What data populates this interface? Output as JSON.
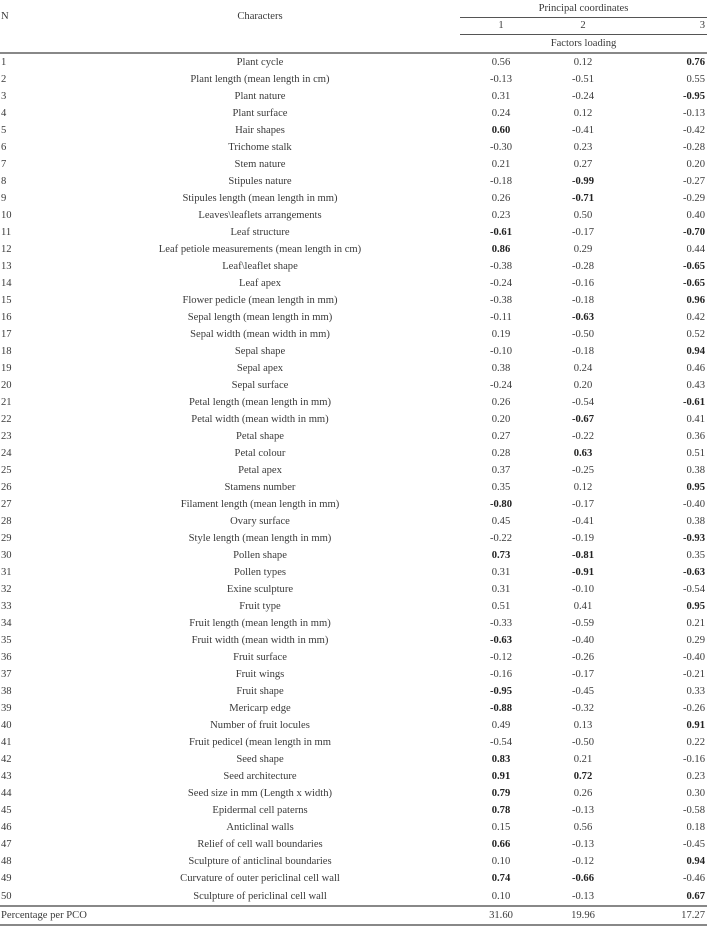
{
  "header": {
    "n_label": "N",
    "characters_label": "Characters",
    "group_label": "Principal coordinates",
    "columns": [
      "1",
      "2",
      "3"
    ],
    "subheader": "Factors loading"
  },
  "rows": [
    {
      "n": "1",
      "character": "Plant cycle",
      "values": [
        "0.56",
        "0.12",
        "0.76"
      ],
      "bold": [
        false,
        false,
        true
      ]
    },
    {
      "n": "2",
      "character": "Plant length (mean length in cm)",
      "values": [
        "-0.13",
        "-0.51",
        "0.55"
      ],
      "bold": [
        false,
        false,
        false
      ]
    },
    {
      "n": "3",
      "character": "Plant nature",
      "values": [
        "0.31",
        "-0.24",
        "-0.95"
      ],
      "bold": [
        false,
        false,
        true
      ]
    },
    {
      "n": "4",
      "character": "Plant surface",
      "values": [
        "0.24",
        "0.12",
        "-0.13"
      ],
      "bold": [
        false,
        false,
        false
      ]
    },
    {
      "n": "5",
      "character": "Hair shapes",
      "values": [
        "0.60",
        "-0.41",
        "-0.42"
      ],
      "bold": [
        true,
        false,
        false
      ]
    },
    {
      "n": "6",
      "character": "Trichome stalk",
      "values": [
        "-0.30",
        "0.23",
        "-0.28"
      ],
      "bold": [
        false,
        false,
        false
      ]
    },
    {
      "n": "7",
      "character": "Stem nature",
      "values": [
        "0.21",
        "0.27",
        "0.20"
      ],
      "bold": [
        false,
        false,
        false
      ]
    },
    {
      "n": "8",
      "character": "Stipules nature",
      "values": [
        "-0.18",
        "-0.99",
        "-0.27"
      ],
      "bold": [
        false,
        true,
        false
      ]
    },
    {
      "n": "9",
      "character": "Stipules length (mean length in mm)",
      "values": [
        "0.26",
        "-0.71",
        "-0.29"
      ],
      "bold": [
        false,
        true,
        false
      ]
    },
    {
      "n": "10",
      "character": "Leaves\\leaflets arrangements",
      "values": [
        "0.23",
        "0.50",
        "0.40"
      ],
      "bold": [
        false,
        false,
        false
      ]
    },
    {
      "n": "11",
      "character": "Leaf structure",
      "values": [
        "-0.61",
        "-0.17",
        "-0.70"
      ],
      "bold": [
        true,
        false,
        true
      ]
    },
    {
      "n": "12",
      "character": "Leaf petiole measurements (mean length in cm)",
      "values": [
        "0.86",
        "0.29",
        "0.44"
      ],
      "bold": [
        true,
        false,
        false
      ]
    },
    {
      "n": "13",
      "character": "Leaf\\leaflet shape",
      "values": [
        "-0.38",
        "-0.28",
        "-0.65"
      ],
      "bold": [
        false,
        false,
        true
      ]
    },
    {
      "n": "14",
      "character": "Leaf apex",
      "values": [
        "-0.24",
        "-0.16",
        "-0.65"
      ],
      "bold": [
        false,
        false,
        true
      ]
    },
    {
      "n": "15",
      "character": "Flower pedicle (mean length in mm)",
      "values": [
        "-0.38",
        "-0.18",
        "0.96"
      ],
      "bold": [
        false,
        false,
        true
      ]
    },
    {
      "n": "16",
      "character": "Sepal length  (mean length in mm)",
      "values": [
        "-0.11",
        "-0.63",
        "0.42"
      ],
      "bold": [
        false,
        true,
        false
      ]
    },
    {
      "n": "17",
      "character": "Sepal width (mean width in mm)",
      "values": [
        "0.19",
        "-0.50",
        "0.52"
      ],
      "bold": [
        false,
        false,
        false
      ]
    },
    {
      "n": "18",
      "character": "Sepal shape",
      "values": [
        "-0.10",
        "-0.18",
        "0.94"
      ],
      "bold": [
        false,
        false,
        true
      ]
    },
    {
      "n": "19",
      "character": "Sepal apex",
      "values": [
        "0.38",
        "0.24",
        "0.46"
      ],
      "bold": [
        false,
        false,
        false
      ]
    },
    {
      "n": "20",
      "character": "Sepal surface",
      "values": [
        "-0.24",
        "0.20",
        "0.43"
      ],
      "bold": [
        false,
        false,
        false
      ]
    },
    {
      "n": "21",
      "character": "Petal length (mean length in mm)",
      "values": [
        "0.26",
        "-0.54",
        "-0.61"
      ],
      "bold": [
        false,
        false,
        true
      ]
    },
    {
      "n": "22",
      "character": "Petal width (mean width in mm)",
      "values": [
        "0.20",
        "-0.67",
        "0.41"
      ],
      "bold": [
        false,
        true,
        false
      ]
    },
    {
      "n": "23",
      "character": "Petal shape",
      "values": [
        "0.27",
        "-0.22",
        "0.36"
      ],
      "bold": [
        false,
        false,
        false
      ]
    },
    {
      "n": "24",
      "character": "Petal colour",
      "values": [
        "0.28",
        "0.63",
        "0.51"
      ],
      "bold": [
        false,
        true,
        false
      ]
    },
    {
      "n": "25",
      "character": "Petal apex",
      "values": [
        "0.37",
        "-0.25",
        "0.38"
      ],
      "bold": [
        false,
        false,
        false
      ]
    },
    {
      "n": "26",
      "character": "Stamens number",
      "values": [
        "0.35",
        "0.12",
        "0.95"
      ],
      "bold": [
        false,
        false,
        true
      ]
    },
    {
      "n": "27",
      "character": "Filament length (mean length in mm)",
      "values": [
        "-0.80",
        "-0.17",
        "-0.40"
      ],
      "bold": [
        true,
        false,
        false
      ]
    },
    {
      "n": "28",
      "character": "Ovary surface",
      "values": [
        "0.45",
        "-0.41",
        "0.38"
      ],
      "bold": [
        false,
        false,
        false
      ]
    },
    {
      "n": "29",
      "character": "Style length (mean length in mm)",
      "values": [
        "-0.22",
        "-0.19",
        "-0.93"
      ],
      "bold": [
        false,
        false,
        true
      ]
    },
    {
      "n": "30",
      "character": "Pollen shape",
      "values": [
        "0.73",
        "-0.81",
        "0.35"
      ],
      "bold": [
        true,
        true,
        false
      ]
    },
    {
      "n": "31",
      "character": "Pollen types",
      "values": [
        "0.31",
        "-0.91",
        "-0.63"
      ],
      "bold": [
        false,
        true,
        true
      ]
    },
    {
      "n": "32",
      "character": "Exine sculpture",
      "values": [
        "0.31",
        "-0.10",
        "-0.54"
      ],
      "bold": [
        false,
        false,
        false
      ]
    },
    {
      "n": "33",
      "character": "Fruit type",
      "values": [
        "0.51",
        "0.41",
        "0.95"
      ],
      "bold": [
        false,
        false,
        true
      ]
    },
    {
      "n": "34",
      "character": "Fruit length (mean length in mm)",
      "values": [
        "-0.33",
        "-0.59",
        "0.21"
      ],
      "bold": [
        false,
        false,
        false
      ]
    },
    {
      "n": "35",
      "character": "Fruit width (mean width in mm)",
      "values": [
        "-0.63",
        "-0.40",
        "0.29"
      ],
      "bold": [
        true,
        false,
        false
      ]
    },
    {
      "n": "36",
      "character": "Fruit surface",
      "values": [
        "-0.12",
        "-0.26",
        "-0.40"
      ],
      "bold": [
        false,
        false,
        false
      ]
    },
    {
      "n": "37",
      "character": "Fruit wings",
      "values": [
        "-0.16",
        "-0.17",
        "-0.21"
      ],
      "bold": [
        false,
        false,
        false
      ]
    },
    {
      "n": "38",
      "character": "Fruit shape",
      "values": [
        "-0.95",
        "-0.45",
        "0.33"
      ],
      "bold": [
        true,
        false,
        false
      ]
    },
    {
      "n": "39",
      "character": "Mericarp edge",
      "values": [
        "-0.88",
        "-0.32",
        "-0.26"
      ],
      "bold": [
        true,
        false,
        false
      ]
    },
    {
      "n": "40",
      "character": "Number of fruit locules",
      "values": [
        "0.49",
        "0.13",
        "0.91"
      ],
      "bold": [
        false,
        false,
        true
      ]
    },
    {
      "n": "41",
      "character": "Fruit pedicel (mean length in mm",
      "values": [
        "-0.54",
        "-0.50",
        "0.22"
      ],
      "bold": [
        false,
        false,
        false
      ]
    },
    {
      "n": "42",
      "character": "Seed shape",
      "values": [
        "0.83",
        "0.21",
        "-0.16"
      ],
      "bold": [
        true,
        false,
        false
      ]
    },
    {
      "n": "43",
      "character": "Seed architecture",
      "values": [
        "0.91",
        "0.72",
        "0.23"
      ],
      "bold": [
        true,
        true,
        false
      ]
    },
    {
      "n": "44",
      "character": "Seed size in mm (Length x width)",
      "values": [
        "0.79",
        "0.26",
        "0.30"
      ],
      "bold": [
        true,
        false,
        false
      ]
    },
    {
      "n": "45",
      "character": "Epidermal cell paterns",
      "values": [
        "0.78",
        "-0.13",
        "-0.58"
      ],
      "bold": [
        true,
        false,
        false
      ]
    },
    {
      "n": "46",
      "character": "Anticlinal walls",
      "values": [
        "0.15",
        "0.56",
        "0.18"
      ],
      "bold": [
        false,
        false,
        false
      ]
    },
    {
      "n": "47",
      "character": "Relief of cell wall boundaries",
      "values": [
        "0.66",
        "-0.13",
        "-0.45"
      ],
      "bold": [
        true,
        false,
        false
      ]
    },
    {
      "n": "48",
      "character": "Sculpture of anticlinal boundaries",
      "values": [
        "0.10",
        "-0.12",
        "0.94"
      ],
      "bold": [
        false,
        false,
        true
      ]
    },
    {
      "n": "49",
      "character": "Curvature of outer periclinal cell wall",
      "values": [
        "0.74",
        "-0.66",
        "-0.46"
      ],
      "bold": [
        true,
        true,
        false
      ]
    },
    {
      "n": "50",
      "character": "Sculpture of periclinal cell wall",
      "values": [
        "0.10",
        "-0.13",
        "0.67"
      ],
      "bold": [
        false,
        false,
        true
      ]
    }
  ],
  "footer": {
    "label": "Percentage per PCO",
    "values": [
      "31.60",
      "19.96",
      "17.27"
    ]
  }
}
